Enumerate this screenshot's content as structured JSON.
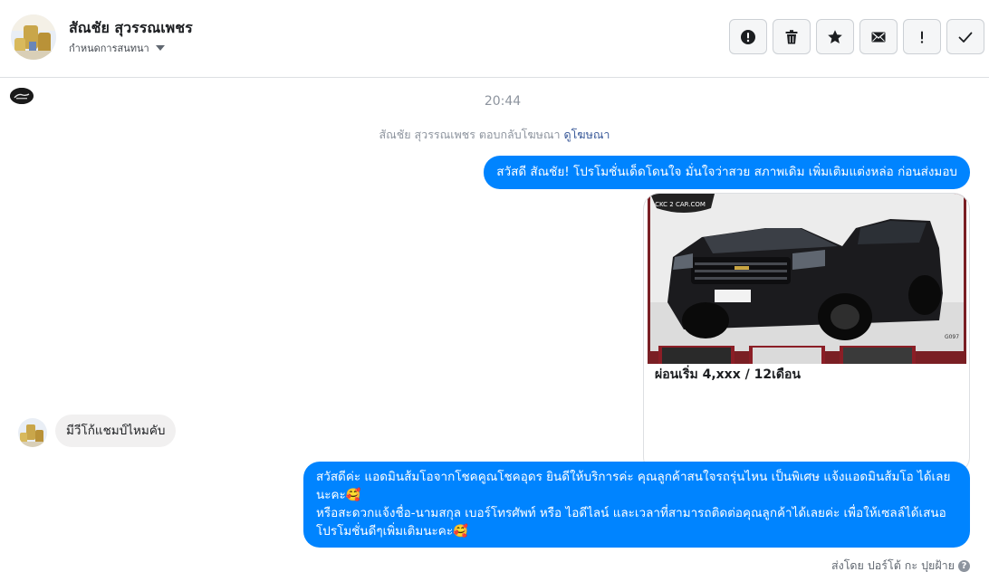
{
  "header": {
    "contact_name": "สัณชัย สุวรรณเพชร",
    "assign_label": "กำหนดการสนทนา",
    "toolbar": [
      {
        "name": "spam-button",
        "icon": "alert-circle-icon"
      },
      {
        "name": "delete-button",
        "icon": "trash-icon"
      },
      {
        "name": "star-button",
        "icon": "star-icon"
      },
      {
        "name": "mark-unread-button",
        "icon": "envelope-icon"
      },
      {
        "name": "follow-up-button",
        "icon": "exclamation-icon"
      },
      {
        "name": "mark-done-button",
        "icon": "checkmark-icon"
      }
    ]
  },
  "conversation": {
    "timestamp": "20:44",
    "system_text": "สัณชัย สุวรรณเพชร ตอบกลับโฆษณา",
    "system_link": "ดูโฆษณา",
    "messages": [
      {
        "direction": "out",
        "text": "สวัสดี สัณชัย! โปรโมชั่นเด็ดโดนใจ มั่นใจว่าสวย สภาพเดิม เพิ่มเติมแต่งหล่อ ก่อนส่งมอบ"
      },
      {
        "direction": "out",
        "type": "card",
        "caption": "ผ่อนเริ่ม 4,xxx / 12เดือน",
        "image_logo_text": "CKC 2 CAR.COM",
        "image_code": "G097"
      },
      {
        "direction": "in",
        "text": "มีวีโก้แชมป์ไหมคับ"
      },
      {
        "direction": "out",
        "lines": [
          "สวัสดีค่ะ แอดมินส้มโอจากโชคคูณโชคอุดร ยินดีให้บริการค่ะ   คุณลูกค้าสนใจรถรุ่นไหน เป็นพิเศษ แจ้งแอดมินส้มโอ ได้เลยนะคะ🥰",
          "หรือสะดวกแจ้งชื่อ-นามสกุล เบอร์โทรศัพท์ หรือ ไอดีไลน์ และเวลาที่สามารถติดต่อคุณลูกค้าได้เลยค่ะ เพื่อให้เซลล์ได้เสนอโปรโมชั่นดีๆเพิ่มเติมนะคะ🥰"
        ]
      }
    ],
    "sent_by": "ส่งโดย ปอร์โต้ กะ ปุยฝ้าย"
  },
  "colors": {
    "outgoing_bubble": "#0084ff",
    "incoming_bubble": "#f1f0f0",
    "link": "#385898"
  }
}
